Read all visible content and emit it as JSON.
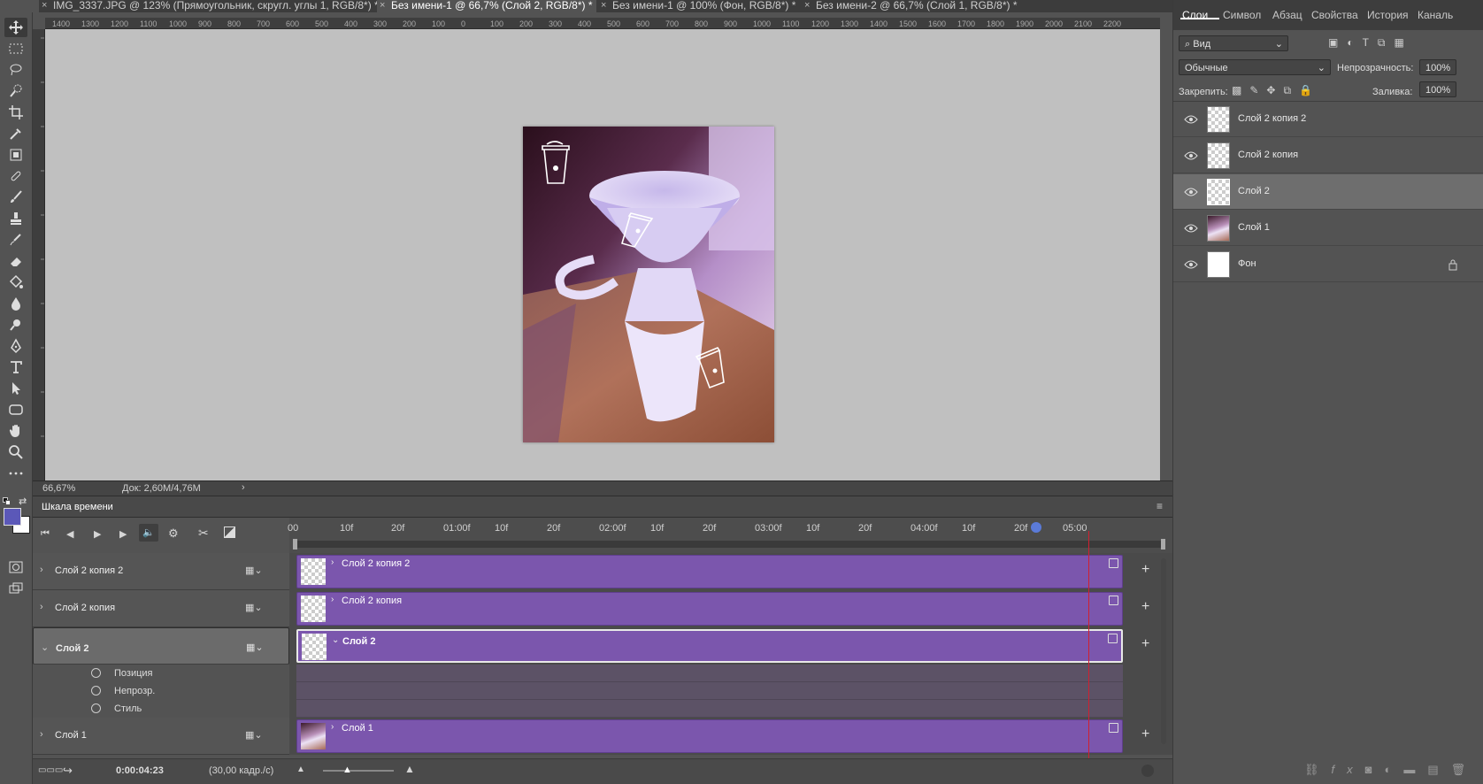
{
  "tabs": [
    {
      "label": "IMG_3337.JPG @ 123% (Прямоугольник, скругл. углы 1, RGB/8*) *"
    },
    {
      "label": "Без имени-1 @ 66,7% (Слой 2, RGB/8*) *"
    },
    {
      "label": "Без имени-1 @ 100% (Фон, RGB/8*) *"
    },
    {
      "label": "Без имени-2 @ 66,7% (Слой 1, RGB/8*) *"
    }
  ],
  "ruler_top": [
    "1400",
    "1300",
    "1200",
    "1100",
    "1000",
    "900",
    "800",
    "700",
    "600",
    "500",
    "400",
    "300",
    "200",
    "100",
    "0",
    "100",
    "200",
    "300",
    "400",
    "500",
    "600",
    "700",
    "800",
    "900",
    "1000",
    "1100",
    "1200",
    "1300",
    "1400",
    "1500",
    "1600",
    "1700",
    "1800",
    "1900",
    "2000",
    "2100",
    "2200"
  ],
  "status": {
    "zoom": "66,67%",
    "doc": "Док: 2,60M/4,76M",
    "arrow": "›"
  },
  "panel_tabs": [
    "Слои",
    "Символ",
    "Абзац",
    "Свойства",
    "История",
    "Каналь"
  ],
  "filter": {
    "kind": "Вид"
  },
  "blend": {
    "mode": "Обычные",
    "opacity_label": "Непрозрачность:",
    "opacity_value": "100%"
  },
  "lock": {
    "label": "Закрепить:",
    "fill_label": "Заливка:",
    "fill_value": "100%"
  },
  "layers": [
    {
      "name": "Слой 2 копия 2",
      "selected": false,
      "thumb": "transparent"
    },
    {
      "name": "Слой 2 копия",
      "selected": false,
      "thumb": "transparent"
    },
    {
      "name": "Слой 2",
      "selected": true,
      "thumb": "transparent"
    },
    {
      "name": "Слой 1",
      "selected": false,
      "thumb": "photo"
    },
    {
      "name": "Фон",
      "selected": false,
      "thumb": "white",
      "locked": true
    }
  ],
  "timeline": {
    "title": "Шкала времени",
    "ruler_labels": [
      "00",
      "10f",
      "20f",
      "01:00f",
      "10f",
      "20f",
      "02:00f",
      "10f",
      "20f",
      "03:00f",
      "10f",
      "20f",
      "04:00f",
      "10f",
      "20f",
      "05:00"
    ],
    "tracks": [
      {
        "name": "Слой 2 копия 2",
        "selected": false,
        "expanded": false,
        "chev": "›",
        "clip": "Слой 2 копия 2"
      },
      {
        "name": "Слой 2 копия",
        "selected": false,
        "expanded": false,
        "chev": "›",
        "clip": "Слой 2 копия"
      },
      {
        "name": "Слой 2",
        "selected": true,
        "expanded": true,
        "chev": "⌄",
        "clip": "Слой 2"
      },
      {
        "name": "Слой 1",
        "selected": false,
        "expanded": false,
        "chev": "›",
        "clip": "Слой 1"
      }
    ],
    "properties": [
      "Позиция",
      "Непрозр.",
      "Стиль"
    ],
    "current_time": "0:00:04:23",
    "fps": "(30,00 кадр./с)"
  },
  "colors": {
    "accent": "#7b56ad",
    "foreground": "#5b58b8",
    "background": "#ffffff"
  }
}
